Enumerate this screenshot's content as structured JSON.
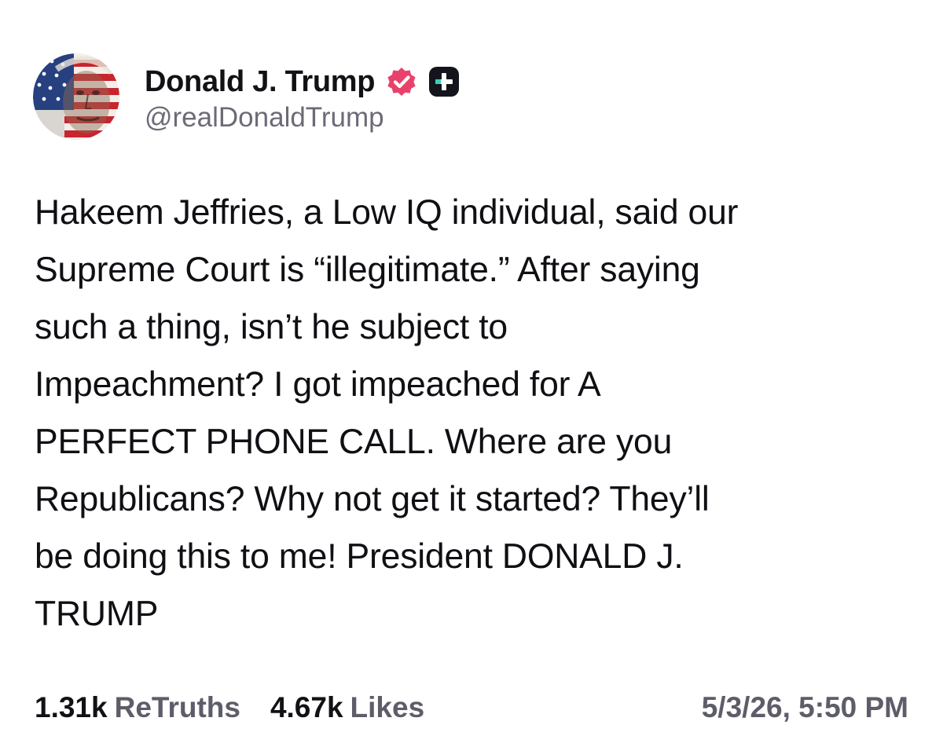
{
  "author": {
    "display_name": "Donald J. Trump",
    "handle": "@realDonaldTrump",
    "verified_icon": "verified-badge-icon",
    "plus_icon": "truth-plus-icon",
    "verified_color": "#e8426b",
    "plus_color": "#14141c"
  },
  "post": {
    "text": "Hakeem Jeffries, a Low IQ individual, said our\nSupreme Court is “illegitimate.” After saying\nsuch a thing, isn’t he subject to\nImpeachment? I got impeached for A\nPERFECT PHONE CALL. Where are you\nRepublicans? Why not get it started? They’ll\nbe doing this to me! President DONALD J.\nTRUMP"
  },
  "stats": {
    "retruths_count": "1.31k",
    "retruths_label": "ReTruths",
    "likes_count": "4.67k",
    "likes_label": "Likes",
    "timestamp": "5/3/26, 5:50 PM"
  }
}
